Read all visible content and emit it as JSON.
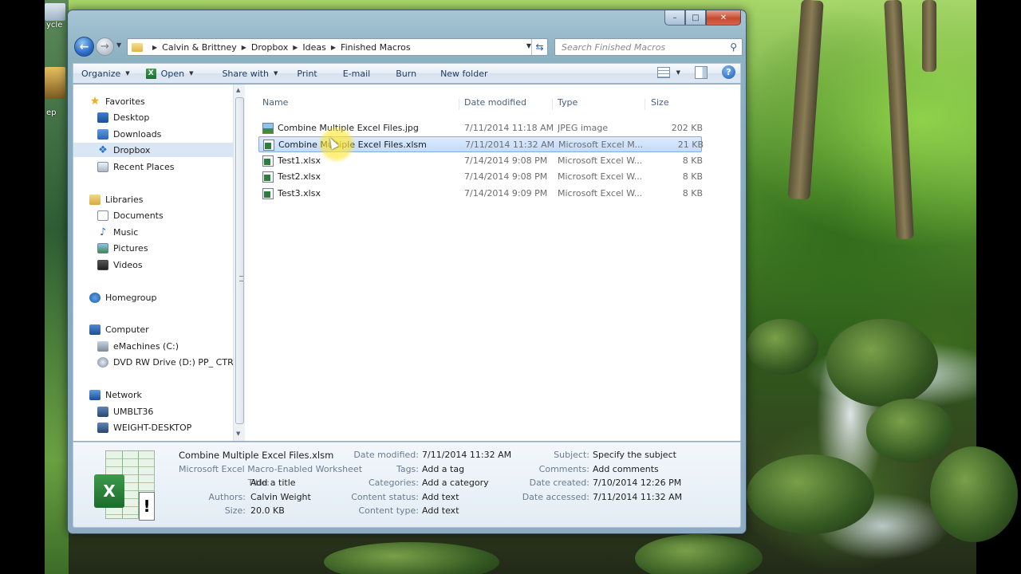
{
  "window": {
    "caption_buttons": {
      "minimize": "–",
      "maximize": "□",
      "close": "✕"
    }
  },
  "desktop": {
    "icon_labels": [
      "ycle",
      "ep"
    ]
  },
  "navigation": {
    "back_icon": "arrow-left",
    "forward_icon": "arrow-right",
    "breadcrumb": [
      "Calvin & Brittney",
      "Dropbox",
      "Ideas",
      "Finished Macros"
    ],
    "search_placeholder": "Search Finished Macros"
  },
  "toolbar": {
    "organize": "Organize",
    "open": "Open",
    "share_with": "Share with",
    "print": "Print",
    "email": "E-mail",
    "burn": "Burn",
    "new_folder": "New folder"
  },
  "sidebar": {
    "favorites": {
      "label": "Favorites",
      "items": [
        "Desktop",
        "Downloads",
        "Dropbox",
        "Recent Places"
      ]
    },
    "libraries": {
      "label": "Libraries",
      "items": [
        "Documents",
        "Music",
        "Pictures",
        "Videos"
      ]
    },
    "homegroup": {
      "label": "Homegroup"
    },
    "computer": {
      "label": "Computer",
      "items": [
        "eMachines (C:)",
        "DVD RW Drive (D:) PP_ CTR-B"
      ]
    },
    "network": {
      "label": "Network",
      "items": [
        "UMBLT36",
        "WEIGHT-DESKTOP"
      ]
    }
  },
  "file_list": {
    "columns": [
      "Name",
      "Date modified",
      "Type",
      "Size"
    ],
    "files": [
      {
        "name": "Combine Multiple Excel Files.jpg",
        "date": "7/11/2014 11:18 AM",
        "type": "JPEG image",
        "size": "202 KB",
        "icon": "jpg"
      },
      {
        "name": "Combine Multiple Excel Files.xlsm",
        "date": "7/11/2014 11:32 AM",
        "type": "Microsoft Excel M...",
        "size": "21 KB",
        "icon": "xl"
      },
      {
        "name": "Test1.xlsx",
        "date": "7/14/2014 9:08 PM",
        "type": "Microsoft Excel W...",
        "size": "8 KB",
        "icon": "xl"
      },
      {
        "name": "Test2.xlsx",
        "date": "7/14/2014 9:08 PM",
        "type": "Microsoft Excel W...",
        "size": "8 KB",
        "icon": "xl"
      },
      {
        "name": "Test3.xlsx",
        "date": "7/14/2014 9:09 PM",
        "type": "Microsoft Excel W...",
        "size": "8 KB",
        "icon": "xl"
      }
    ],
    "selected_index": 1
  },
  "details": {
    "file_name": "Combine Multiple Excel Files.xlsm",
    "file_type": "Microsoft Excel Macro-Enabled Worksheet",
    "icon_letter": "X",
    "warn_glyph": "!",
    "col1": [
      {
        "label": "Title:",
        "value": "Add a title"
      },
      {
        "label": "Authors:",
        "value": "Calvin Weight"
      },
      {
        "label": "Size:",
        "value": "20.0 KB"
      }
    ],
    "col2": [
      {
        "label": "Date modified:",
        "value": "7/11/2014 11:32 AM"
      },
      {
        "label": "Tags:",
        "value": "Add a tag"
      },
      {
        "label": "Categories:",
        "value": "Add a category"
      },
      {
        "label": "Content status:",
        "value": "Add text"
      },
      {
        "label": "Content type:",
        "value": "Add text"
      }
    ],
    "col3": [
      {
        "label": "Subject:",
        "value": "Specify the subject"
      },
      {
        "label": "Comments:",
        "value": "Add comments"
      },
      {
        "label": "Date created:",
        "value": "7/10/2014 12:26 PM"
      },
      {
        "label": "Date accessed:",
        "value": "7/11/2014 11:32 AM"
      }
    ]
  }
}
